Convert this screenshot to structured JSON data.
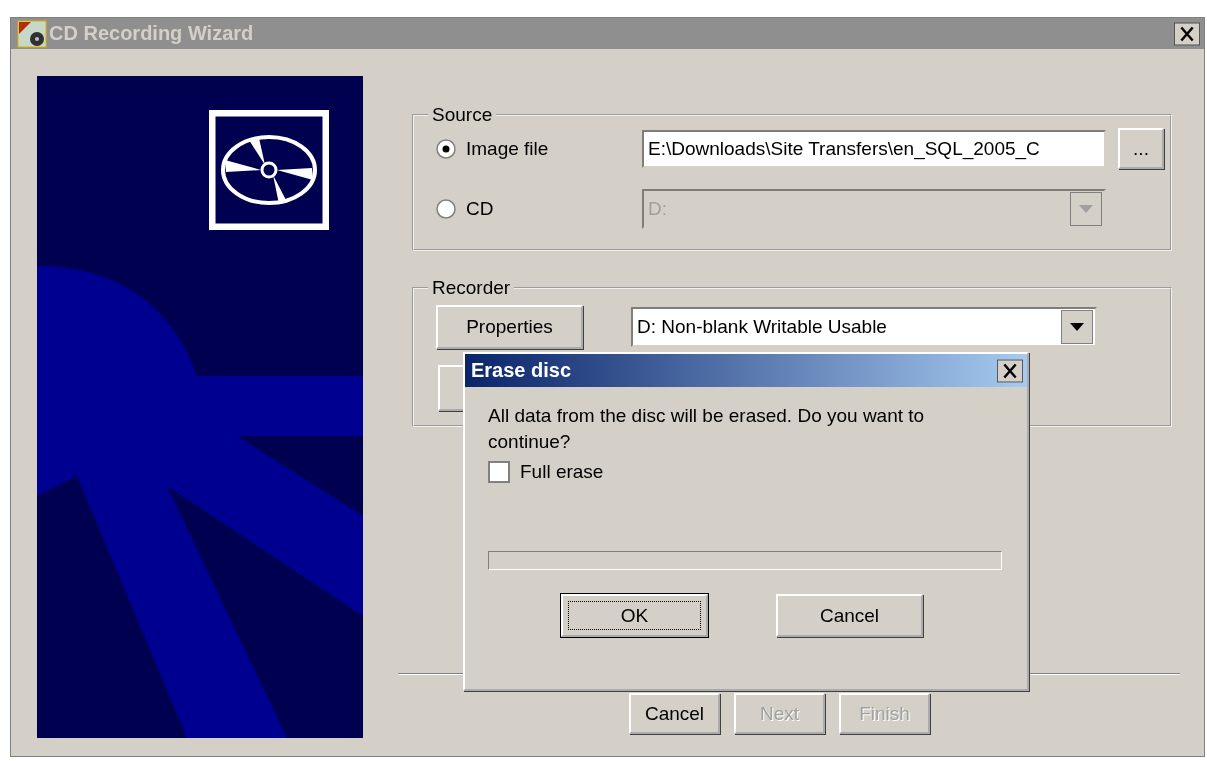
{
  "window": {
    "title": "CD Recording Wizard",
    "active": false
  },
  "source": {
    "label": "Source",
    "options": [
      {
        "label": "Image file",
        "selected": true
      },
      {
        "label": "CD",
        "selected": false
      }
    ],
    "image_path": {
      "value": "E:\\Downloads\\Site Transfers\\en_SQL_2005_C"
    },
    "browse_button": "...",
    "drive": {
      "value": "D:",
      "disabled": true
    }
  },
  "recorder": {
    "label": "Recorder",
    "properties_button": "Properties",
    "device": {
      "value": "D: Non-blank Writable Usable",
      "disabled": false
    }
  },
  "buttons": [
    {
      "label": "Cancel",
      "disabled": false
    },
    {
      "label": "Next",
      "disabled": true
    },
    {
      "label": "Finish",
      "disabled": true
    }
  ],
  "dialog": {
    "title": "Erase disc",
    "active": true,
    "message": "All data from the disc will be erased. Do you want to continue?",
    "full_erase": {
      "label": "Full erase",
      "checked": false
    },
    "progress": {
      "level": 0
    },
    "buttons": [
      {
        "label": "OK",
        "default": true
      },
      {
        "label": "Cancel",
        "default": false
      }
    ]
  }
}
